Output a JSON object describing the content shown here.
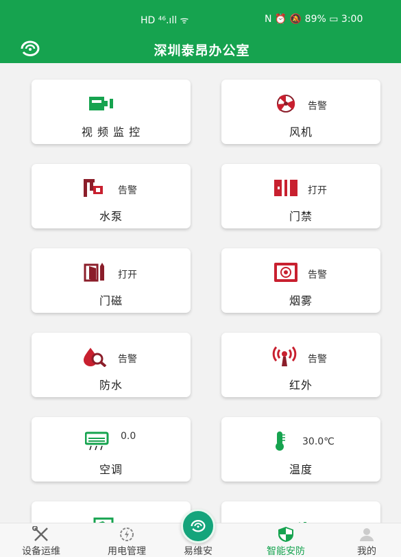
{
  "status_bar": {
    "network": "HD ⁴⁶.ıll ᯤ",
    "right": "N ⏰ 🔕 89% ▭ 3:00"
  },
  "header": {
    "title": "深圳泰昂办公室",
    "color": "#16a34f"
  },
  "cards": [
    {
      "label": "视 频 监 控",
      "status": "",
      "icon": "video-camera-icon"
    },
    {
      "label": "风机",
      "status": "告警",
      "icon": "fan-icon"
    },
    {
      "label": "水泵",
      "status": "告警",
      "icon": "water-pump-icon"
    },
    {
      "label": "门禁",
      "status": "打开",
      "icon": "access-control-icon"
    },
    {
      "label": "门磁",
      "status": "打开",
      "icon": "door-magnet-icon"
    },
    {
      "label": "烟雾",
      "status": "告警",
      "icon": "smoke-detector-icon"
    },
    {
      "label": "防水",
      "status": "告警",
      "icon": "water-leak-icon"
    },
    {
      "label": "红外",
      "status": "告警",
      "icon": "infrared-icon"
    },
    {
      "label": "空调",
      "status": "0.0",
      "icon": "air-conditioner-icon"
    },
    {
      "label": "温度",
      "status": "30.0℃",
      "icon": "thermometer-icon"
    }
  ],
  "bottom_nav": [
    {
      "label": "设备运维",
      "icon": "tools-icon",
      "active": false
    },
    {
      "label": "用电管理",
      "icon": "power-gear-icon",
      "active": false
    },
    {
      "label": "易维安",
      "icon": "app-logo-icon",
      "active": false
    },
    {
      "label": "智能安防",
      "icon": "shield-icon",
      "active": true
    },
    {
      "label": "我的",
      "icon": "user-icon",
      "active": false
    }
  ],
  "colors": {
    "accent": "#16a34f",
    "alert_red": "#c8202f",
    "dark_red": "#8b1e2a"
  }
}
